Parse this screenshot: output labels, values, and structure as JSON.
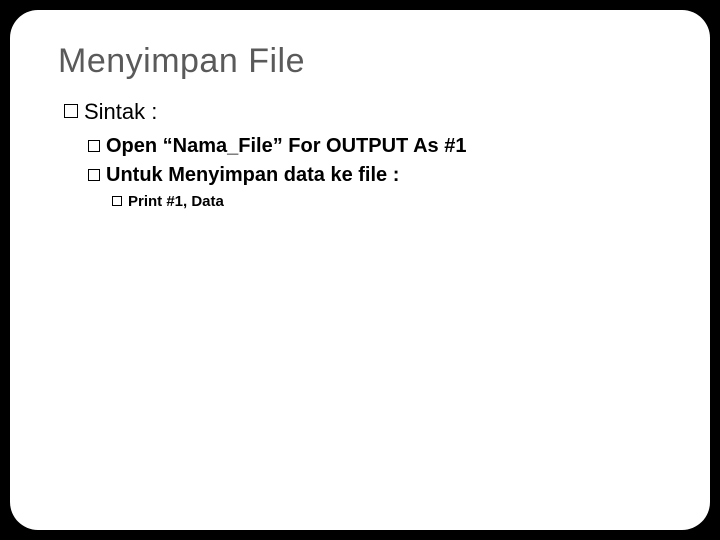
{
  "slide": {
    "title": "Menyimpan File",
    "l1_bullet1": "Sintak :",
    "l2_bullet1": "Open “Nama_File” For  OUTPUT As #1",
    "l2_bullet2": "Untuk Menyimpan data ke file :",
    "l3_bullet1": "Print #1, Data"
  }
}
